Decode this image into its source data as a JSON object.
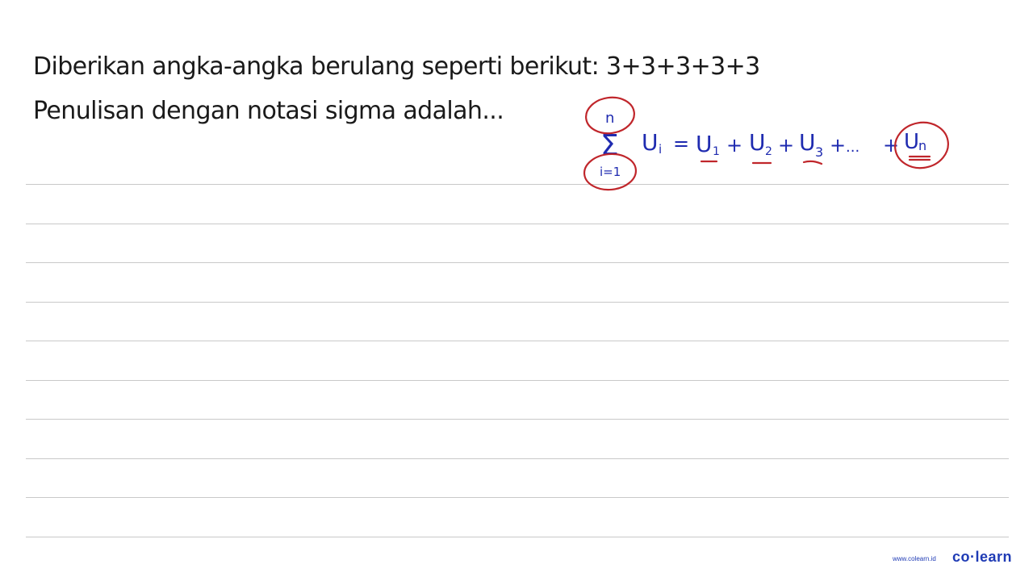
{
  "question": {
    "line1": "Diberikan angka-angka berulang seperti berikut: 3+3+3+3+3",
    "line2": "Penulisan dengan notasi sigma adalah..."
  },
  "handwriting": {
    "sigma_upper": "n",
    "sigma_symbol": "Σ",
    "sigma_lower": "i=1",
    "term": "U",
    "term_index": "i",
    "equals": "=",
    "terms": [
      {
        "base": "U",
        "sub": "1"
      },
      {
        "base": "U",
        "sub": "2"
      },
      {
        "base": "U",
        "sub": "3"
      },
      {
        "base": "U",
        "sub": "n"
      }
    ],
    "plus": "+",
    "ellipsis": "...",
    "ink_color": "#1f2bb0",
    "annotation_color": "#c0262b"
  },
  "footer": {
    "url": "www.colearn.id",
    "logo": "co·learn",
    "brand_color": "#1f3bb5"
  }
}
